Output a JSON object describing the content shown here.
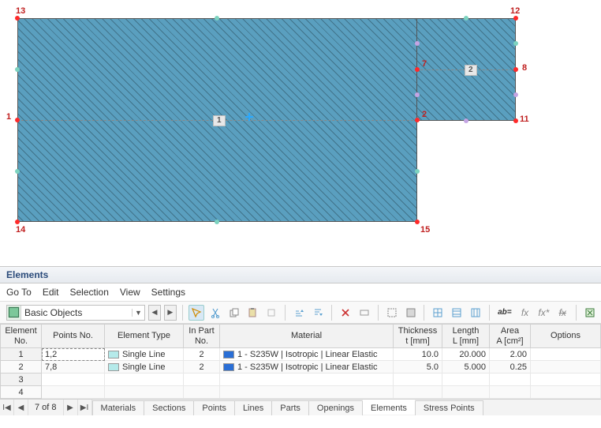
{
  "panel": {
    "title": "Elements"
  },
  "menu": {
    "goto": "Go To",
    "edit": "Edit",
    "selection": "Selection",
    "view": "View",
    "settings": "Settings"
  },
  "combo": {
    "text": "Basic Objects"
  },
  "nodes": {
    "n1": "1",
    "n2": "2",
    "n7": "7",
    "n8": "8",
    "n11": "11",
    "n12": "12",
    "n13": "13",
    "n14": "14",
    "n15": "15"
  },
  "elem_labels": {
    "e1": "1",
    "e2": "2"
  },
  "columns": {
    "element_no": "Element\nNo.",
    "points_no": "Points No.",
    "element_type": "Element Type",
    "in_part_no": "In Part\nNo.",
    "material": "Material",
    "thickness": "Thickness\nt [mm]",
    "length": "Length\nL [mm]",
    "area": "Area\nA [cm²]",
    "options": "Options"
  },
  "rows": [
    {
      "no": "1",
      "points": "1,2",
      "type": "Single Line",
      "part": "2",
      "material": "1 - S235W | Isotropic | Linear Elastic",
      "thk": "10.0",
      "len": "20.000",
      "area": "2.00",
      "opt": ""
    },
    {
      "no": "2",
      "points": "7,8",
      "type": "Single Line",
      "part": "2",
      "material": "1 - S235W | Isotropic | Linear Elastic",
      "thk": "5.0",
      "len": "5.000",
      "area": "0.25",
      "opt": ""
    },
    {
      "no": "3",
      "points": "",
      "type": "",
      "part": "",
      "material": "",
      "thk": "",
      "len": "",
      "area": "",
      "opt": ""
    },
    {
      "no": "4",
      "points": "",
      "type": "",
      "part": "",
      "material": "",
      "thk": "",
      "len": "",
      "area": "",
      "opt": ""
    }
  ],
  "nav": {
    "pos": "7 of 8"
  },
  "tabs": {
    "materials": "Materials",
    "sections": "Sections",
    "points": "Points",
    "lines": "Lines",
    "parts": "Parts",
    "openings": "Openings",
    "elements": "Elements",
    "stress": "Stress Points"
  },
  "toolbar": {
    "ab": "ab=",
    "fx": "fx",
    "fxstar": "fx*",
    "fxstrike": "fx"
  }
}
